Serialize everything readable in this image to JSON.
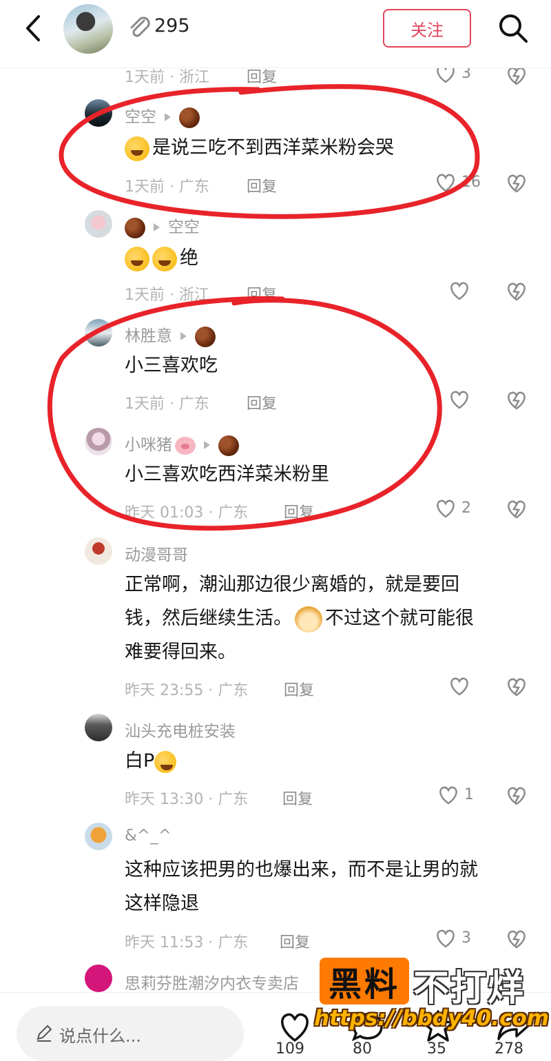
{
  "header": {
    "follower_count": "295",
    "follow_label": "关注"
  },
  "comments": [
    {
      "name": "",
      "text": "",
      "time": "1天前 · 浙江",
      "reply": "回复",
      "likes": "3"
    },
    {
      "name": "空空",
      "text": "是说三吃不到西洋菜米粉会哭",
      "time": "1天前 · 广东",
      "reply": "回复",
      "likes": "16"
    },
    {
      "name": "空空",
      "text": "绝",
      "time": "1天前 · 浙江",
      "reply": "回复",
      "likes": ""
    },
    {
      "name": "林胜意",
      "text": "小三喜欢吃",
      "time": "1天前 · 广东",
      "reply": "回复",
      "likes": ""
    },
    {
      "name": "小咪猪",
      "text": "小三喜欢吃西洋菜米粉里",
      "time": "昨天 01:03 · 广东",
      "reply": "回复",
      "likes": "2"
    },
    {
      "name": "动漫哥哥",
      "text_line1": "正常啊，潮汕那边很少离婚的，就是要回",
      "text_line2a": "钱，然后继续生活。",
      "text_line2b": "不过这个就可能很",
      "text_line3": "难要得回来。",
      "time": "昨天 23:55 · 广东",
      "reply": "回复",
      "likes": ""
    },
    {
      "name": "汕头充电桩安装",
      "text": "白P",
      "time": "昨天 13:30 · 广东",
      "reply": "回复",
      "likes": "1"
    },
    {
      "name": "&^_^",
      "text_line1": "这种应该把男的也爆出来，而不是让男的就",
      "text_line2": "这样隐退",
      "time": "昨天 11:53 · 广东",
      "reply": "回复",
      "likes": "3"
    },
    {
      "name": "思莉芬胜潮汐内衣专卖店"
    }
  ],
  "bottom_bar": {
    "input_placeholder": "说点什么...",
    "like_count": "109",
    "comment_count": "80",
    "star_count": "35",
    "share_count": "278"
  },
  "watermark": {
    "box_text": "黑料",
    "right_text": "不打烊",
    "url": "https://bbdy40.com"
  },
  "colors": {
    "accent": "#e3445a",
    "annotation": "#e8232a",
    "watermark_orange": "#ff7a00"
  }
}
